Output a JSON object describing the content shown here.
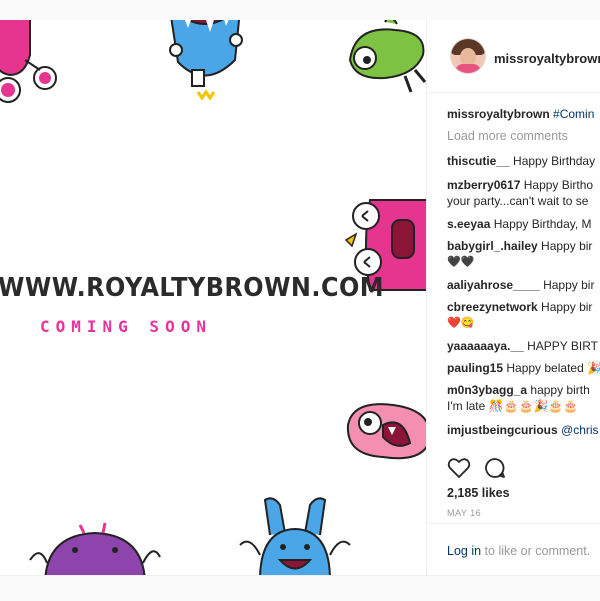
{
  "post": {
    "image": {
      "site_url": "WWW.ROYALTYBROWN.COM",
      "tagline": "COMING SOON",
      "tagline_color": "#e8329d"
    },
    "header": {
      "username": "missroyaltybrown"
    },
    "caption": {
      "username": "missroyaltybrown",
      "text": "#Comin"
    },
    "load_more": "Load more comments",
    "comments": [
      {
        "user": "thiscutie__",
        "text": "Happy Birthday"
      },
      {
        "user": "mzberry0617",
        "text": "Happy Birtho",
        "text2": "your party...can't wait to se"
      },
      {
        "user": "s.eeyaa",
        "text": "Happy Birthday, M"
      },
      {
        "user": "babygirl_.hailey",
        "text": "Happy bir",
        "text2": "🖤🖤"
      },
      {
        "user": "aaliyahrose____",
        "text": "Happy bir"
      },
      {
        "user": "cbreezynetwork",
        "text": "Happy bir",
        "text2": "❤️😋"
      },
      {
        "user": "yaaaaaaya.__",
        "text": "HAPPY BIRT"
      },
      {
        "user": "pauling15",
        "text": "Happy belated 🎉"
      },
      {
        "user": "m0n3ybagg_a",
        "text": "happy birth",
        "text2": "I'm late 🎊🎂🎂🎉🎂🎂"
      },
      {
        "user": "imjustbeingcurious",
        "text": "@chris"
      }
    ],
    "actions": {
      "like_icon": "heart-icon",
      "comment_icon": "comment-bubble-icon"
    },
    "likes": "2,185 likes",
    "date": "MAY 16",
    "login": {
      "link": "Log in",
      "rest": "to like or comment."
    }
  }
}
